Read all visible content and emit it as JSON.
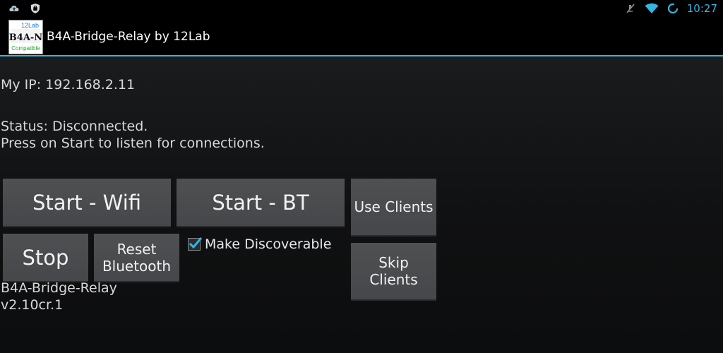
{
  "status_bar": {
    "time": "10:27",
    "left_icons": [
      "cloud-upload-icon",
      "shield-icon"
    ],
    "right_icons": [
      "mute-icon",
      "wifi-icon",
      "sync-icon"
    ],
    "accent_color": "#33b5e5"
  },
  "action_bar": {
    "title": "B4A-Bridge-Relay by 12Lab",
    "logo": {
      "top_text": "12Lab",
      "main_text": "B4A-N",
      "bottom_text": "Compatible"
    }
  },
  "info": {
    "ip_text": "My IP: 192.168.2.11",
    "status_line1": "Status: Disconnected.",
    "status_line2": "Press on Start to listen for connections."
  },
  "buttons": {
    "start_wifi": "Start - Wifi",
    "start_bt": "Start - BT",
    "use_clients": "Use Clients",
    "stop": "Stop",
    "reset_bt_line1": "Reset",
    "reset_bt_line2": "Bluetooth",
    "skip_clients_line1": "Skip",
    "skip_clients_line2": "Clients"
  },
  "make_discoverable": {
    "label": "Make Discoverable",
    "checked": true
  },
  "version": {
    "line1": "B4A-Bridge-Relay",
    "line2": "v2.10cr.1"
  }
}
